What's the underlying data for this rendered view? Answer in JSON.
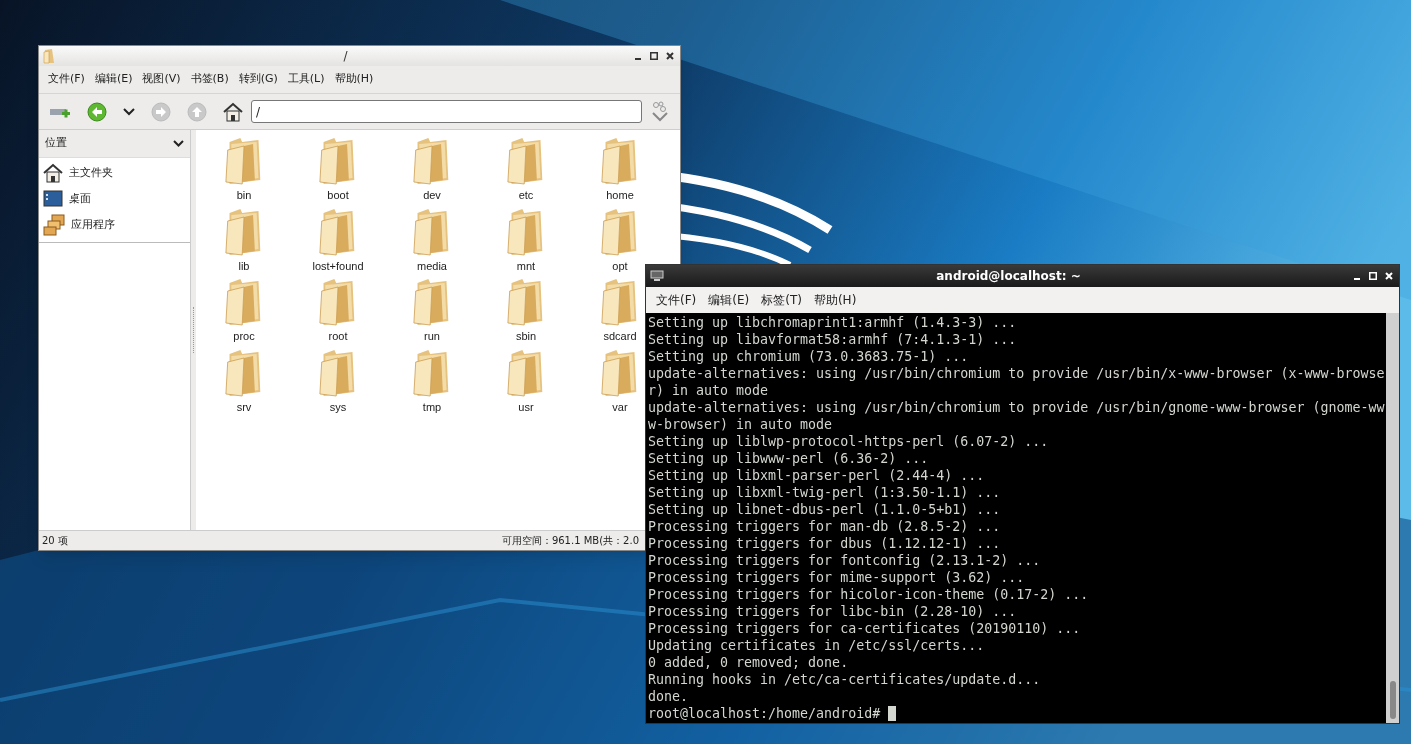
{
  "file_manager": {
    "title": "/",
    "menu": [
      "文件(F)",
      "编辑(E)",
      "视图(V)",
      "书签(B)",
      "转到(G)",
      "工具(L)",
      "帮助(H)"
    ],
    "toolbar": [
      {
        "kind": "new-tab",
        "disabled": false
      },
      {
        "kind": "back",
        "disabled": false
      },
      {
        "kind": "history",
        "disabled": false
      },
      {
        "kind": "forward",
        "disabled": true
      },
      {
        "kind": "up",
        "disabled": true
      },
      {
        "kind": "home",
        "disabled": false
      }
    ],
    "location": "/",
    "sidebar": {
      "header": "位置",
      "items": [
        {
          "label": "主文件夹",
          "kind": "home"
        },
        {
          "label": "桌面",
          "kind": "desktop"
        },
        {
          "label": "应用程序",
          "kind": "apps"
        }
      ]
    },
    "folders": [
      "bin",
      "boot",
      "dev",
      "etc",
      "home",
      "lib",
      "lost+found",
      "media",
      "mnt",
      "opt",
      "proc",
      "root",
      "run",
      "sbin",
      "sdcard",
      "srv",
      "sys",
      "tmp",
      "usr",
      "var"
    ],
    "status_left": "20 项",
    "status_right": "可用空间：961.1 MB(共：2.0"
  },
  "terminal": {
    "title": "android@localhost: ~",
    "menu": [
      "文件(F)",
      "编辑(E)",
      "标签(T)",
      "帮助(H)"
    ],
    "lines": [
      "Setting up libchromaprint1:armhf (1.4.3-3) ...",
      "Setting up libavformat58:armhf (7:4.1.3-1) ...",
      "Setting up chromium (73.0.3683.75-1) ...",
      "update-alternatives: using /usr/bin/chromium to provide /usr/bin/x-www-browser (x-www-browse",
      "r) in auto mode",
      "update-alternatives: using /usr/bin/chromium to provide /usr/bin/gnome-www-browser (gnome-ww",
      "w-browser) in auto mode",
      "Setting up liblwp-protocol-https-perl (6.07-2) ...",
      "Setting up libwww-perl (6.36-2) ...",
      "Setting up libxml-parser-perl (2.44-4) ...",
      "Setting up libxml-twig-perl (1:3.50-1.1) ...",
      "Setting up libnet-dbus-perl (1.1.0-5+b1) ...",
      "Processing triggers for man-db (2.8.5-2) ...",
      "Processing triggers for dbus (1.12.12-1) ...",
      "Processing triggers for fontconfig (2.13.1-2) ...",
      "Processing triggers for mime-support (3.62) ...",
      "Processing triggers for hicolor-icon-theme (0.17-2) ...",
      "Processing triggers for libc-bin (2.28-10) ...",
      "Processing triggers for ca-certificates (20190110) ...",
      "Updating certificates in /etc/ssl/certs...",
      "0 added, 0 removed; done.",
      "Running hooks in /etc/ca-certificates/update.d...",
      "done."
    ],
    "prompt": "root@localhost:/home/android#"
  }
}
